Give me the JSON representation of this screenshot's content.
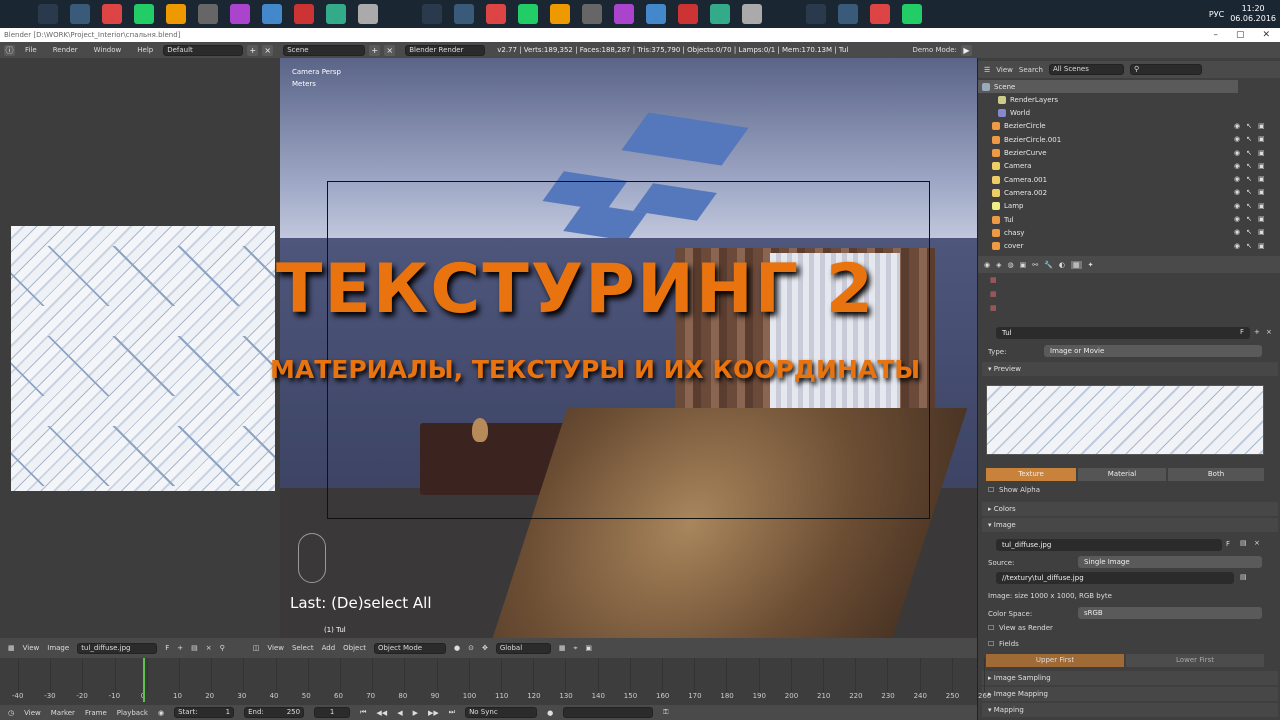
{
  "taskbar": {
    "lang": "РУС",
    "time": "11:20",
    "date": "06.06.2016",
    "icons": [
      "windows-icon",
      "search-icon",
      "shield-icon",
      "chrome-icon",
      "steam-icon",
      "settings-icon",
      "notes-icon",
      "vivaldi-icon",
      "photos-icon",
      "record-icon",
      "explorer-icon",
      "paint-icon",
      "folder-icon",
      "terminal-icon",
      "blender-icon",
      "tools-icon",
      "app-icon",
      "ram-icon",
      "ae-icon",
      "ps-icon",
      "viber-icon",
      "au-icon",
      "nvidia-icon",
      "epic-icon",
      "network-icon",
      "skype-icon",
      "tablet-icon",
      "image-icon",
      "blender-icon"
    ]
  },
  "window": {
    "title": "Blender [D:\\WORK\\Project_Interior\\спальня.blend]"
  },
  "menubar": {
    "items": [
      "File",
      "Render",
      "Window",
      "Help"
    ],
    "layout": "Default",
    "scene": "Scene",
    "engine": "Blender Render",
    "stats": "v2.77 | Verts:189,352 | Faces:188,287 | Tris:375,790 | Objects:0/70 | Lamps:0/1 | Mem:170.13M | Tul",
    "demo": "Demo Mode:"
  },
  "viewport": {
    "camera": "Camera Persp",
    "units": "Meters",
    "last_op": "Last: (De)select All",
    "object": "(1) Tul"
  },
  "overlay": {
    "title": "ТЕКСТУРИНГ 2",
    "subtitle": "МАТЕРИАЛЫ, ТЕКСТУРЫ И ИХ КООРДИНАТЫ"
  },
  "outliner": {
    "menu": [
      "View",
      "Search"
    ],
    "filter": "All Scenes",
    "rows": [
      "Scene",
      "RenderLayers",
      "World",
      "BezierCircle",
      "BezierCircle.001",
      "BezierCurve",
      "Camera",
      "Camera.001",
      "Camera.002",
      "Lamp",
      "Tul",
      "chasy",
      "cover"
    ]
  },
  "props": {
    "texture_name": "Tul",
    "type_label": "Type:",
    "type_value": "Image or Movie",
    "preview": "Preview",
    "tabs": [
      "Texture",
      "Material",
      "Both"
    ],
    "show_alpha": "Show Alpha",
    "colors": "Colors",
    "image": "Image",
    "image_name": "tul_diffuse.jpg",
    "source_label": "Source:",
    "source_value": "Single Image",
    "path": "//textury\\tul_diffuse.jpg",
    "image_info": "Image: size 1000 x 1000, RGB byte",
    "color_space_label": "Color Space:",
    "color_space_value": "sRGB",
    "view_as_render": "View as Render",
    "fields": "Fields",
    "upper_first": "Upper First",
    "lower_first": "Lower First",
    "image_sampling": "Image Sampling",
    "image_mapping": "Image Mapping",
    "mapping": "Mapping"
  },
  "uvheader": {
    "items": [
      "View",
      "Image"
    ],
    "image": "tul_diffuse.jpg",
    "f": "F"
  },
  "vpheader": {
    "items": [
      "View",
      "Select",
      "Add",
      "Object"
    ],
    "mode": "Object Mode",
    "orient": "Global"
  },
  "timeline": {
    "ticks": [
      "-40",
      "-30",
      "-20",
      "-10",
      "0",
      "10",
      "20",
      "30",
      "40",
      "50",
      "60",
      "70",
      "80",
      "90",
      "100",
      "110",
      "120",
      "130",
      "140",
      "150",
      "160",
      "170",
      "180",
      "190",
      "200",
      "210",
      "220",
      "230",
      "240",
      "250",
      "260"
    ],
    "controls": [
      "View",
      "Marker",
      "Frame",
      "Playback"
    ],
    "start_label": "Start:",
    "start": "1",
    "end_label": "End:",
    "end": "250",
    "current": "1",
    "sync": "No Sync"
  }
}
